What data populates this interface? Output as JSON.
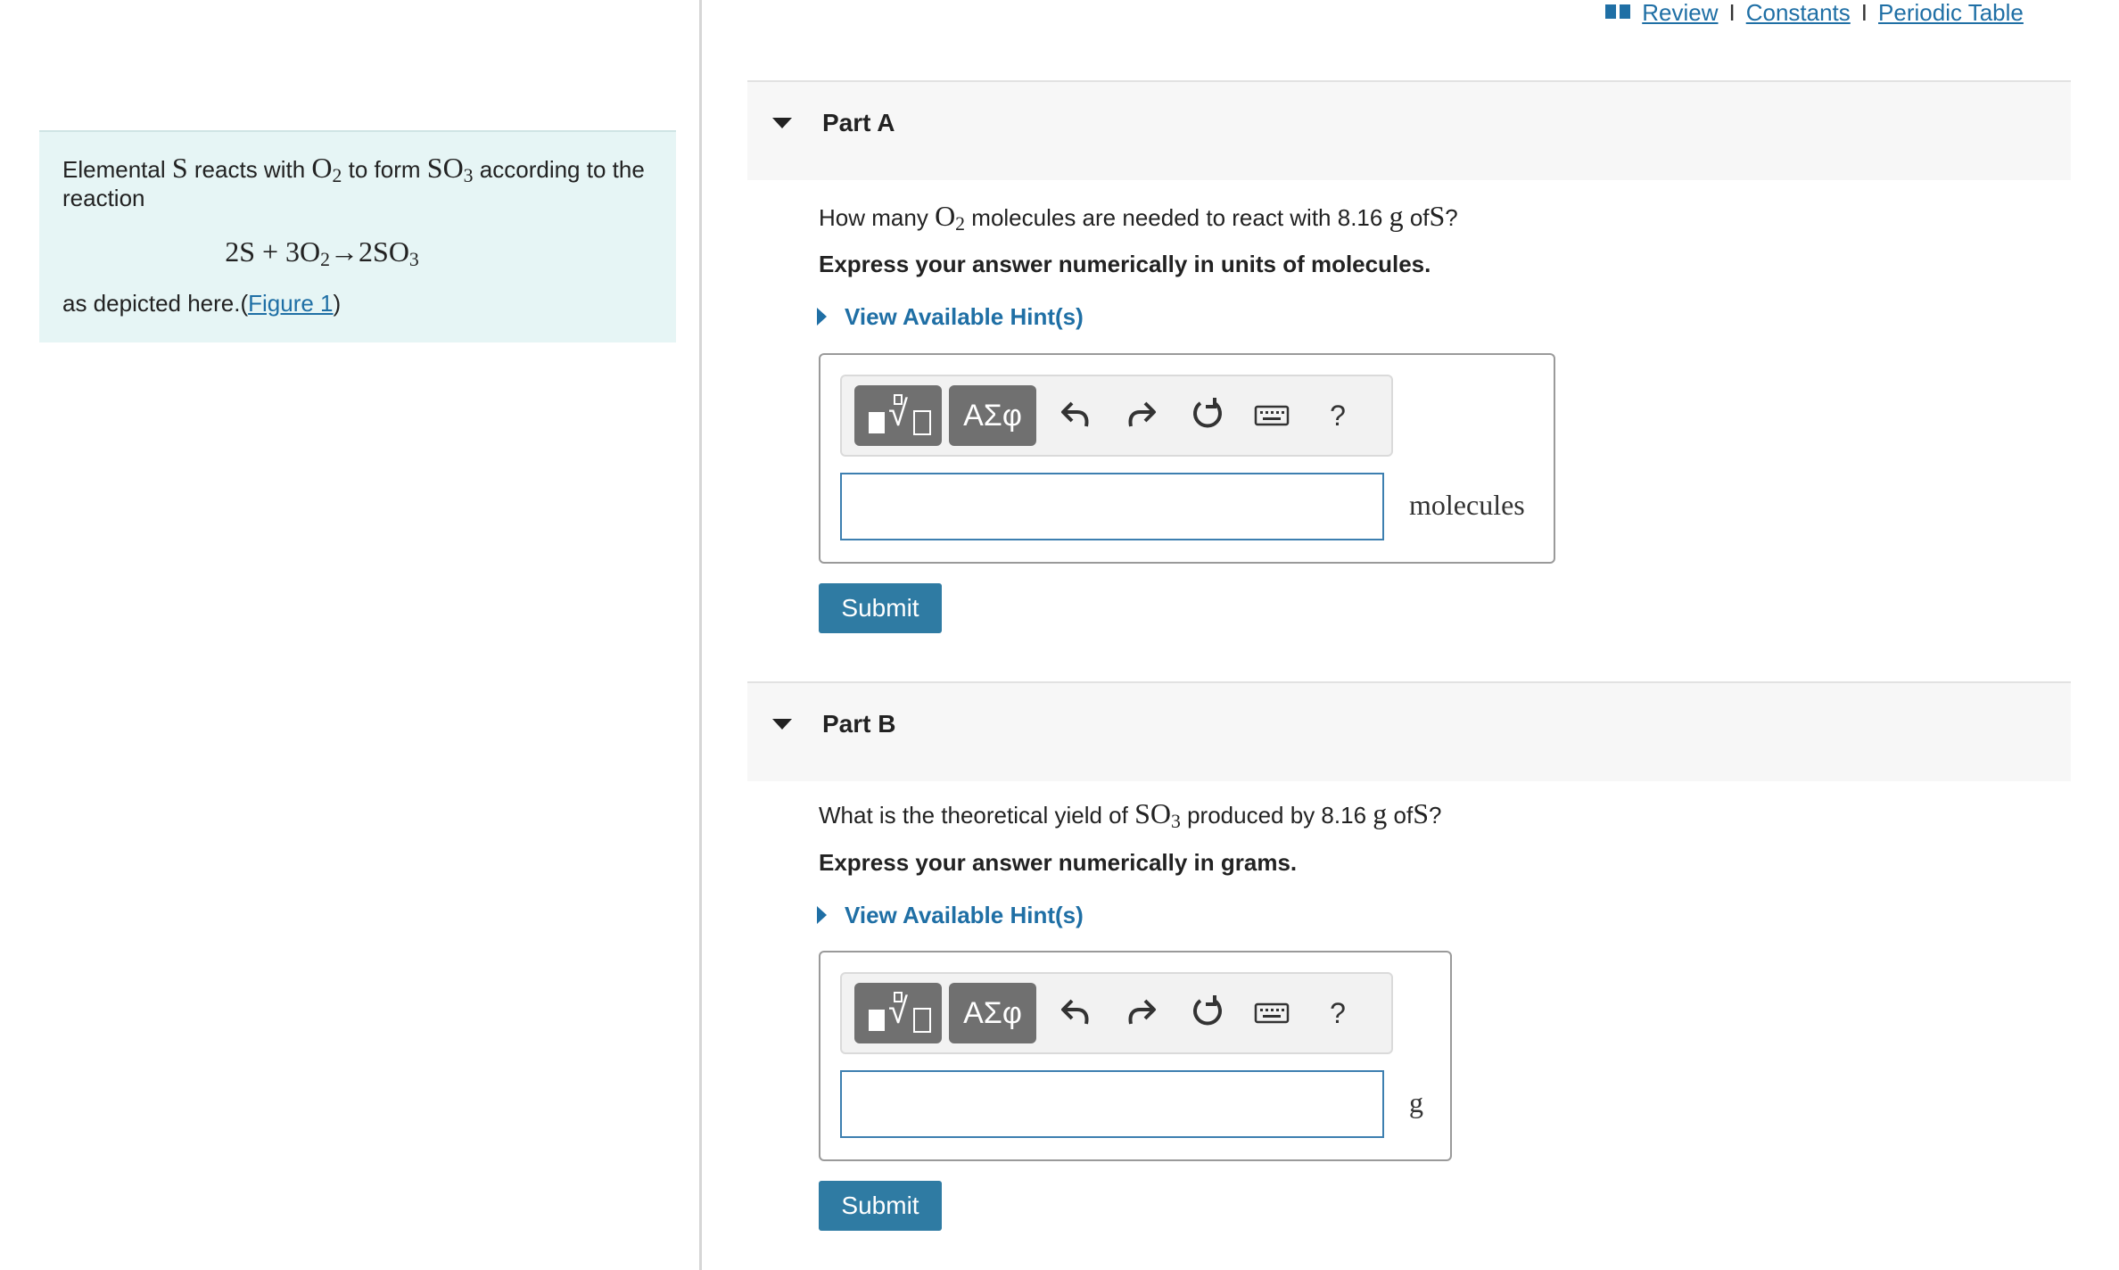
{
  "top_links": {
    "review": "Review",
    "separator": "I",
    "constants": "Constants",
    "periodic_table": "Periodic Table"
  },
  "intro": {
    "text_1": "Elemental",
    "element_s": "S",
    "text_2": "reacts with",
    "o2_base": "O",
    "o2_sub": "2",
    "text_3": "to form",
    "so3_base": "SO",
    "so3_sub": "3",
    "text_4": "according to the reaction",
    "equation": {
      "part1": "2S + 3O",
      "sub1": "2",
      "part2": "→2SO",
      "sub2": "3"
    },
    "text_5": "as depicted here.(",
    "figure_link": "Figure 1",
    "text_6": ")"
  },
  "part_a": {
    "title": "Part A",
    "q_1": "How many",
    "q_o2_base": "O",
    "q_o2_sub": "2",
    "q_2": "molecules are needed to react with 8.16",
    "q_unit": "g",
    "q_3": "of",
    "q_s": "S",
    "q_4": "?",
    "instruction": "Express your answer numerically in units of molecules.",
    "hint": "View Available Hint(s)",
    "input_value": "",
    "unit": "molecules",
    "submit": "Submit"
  },
  "part_b": {
    "title": "Part B",
    "q_1": "What is the theoretical yield of",
    "q_so3_base": "SO",
    "q_so3_sub": "3",
    "q_2": "produced by 8.16",
    "q_unit": "g",
    "q_3": "of",
    "q_s": "S",
    "q_4": "?",
    "instruction": "Express your answer numerically in grams.",
    "hint": "View Available Hint(s)",
    "input_value": "",
    "unit": "g",
    "submit": "Submit"
  },
  "toolbar": {
    "symbols_label": "ΑΣφ",
    "help_label": "?",
    "icons": [
      "templates-icon",
      "symbols-icon",
      "undo-icon",
      "redo-icon",
      "reset-icon",
      "keyboard-icon",
      "help-icon"
    ]
  },
  "colors": {
    "link": "#1f6fa5",
    "submit_bg": "#2f7ba3",
    "intro_bg": "#e6f5f5",
    "toolbar_btn_bg": "#707070",
    "input_border": "#3d7fb0"
  }
}
